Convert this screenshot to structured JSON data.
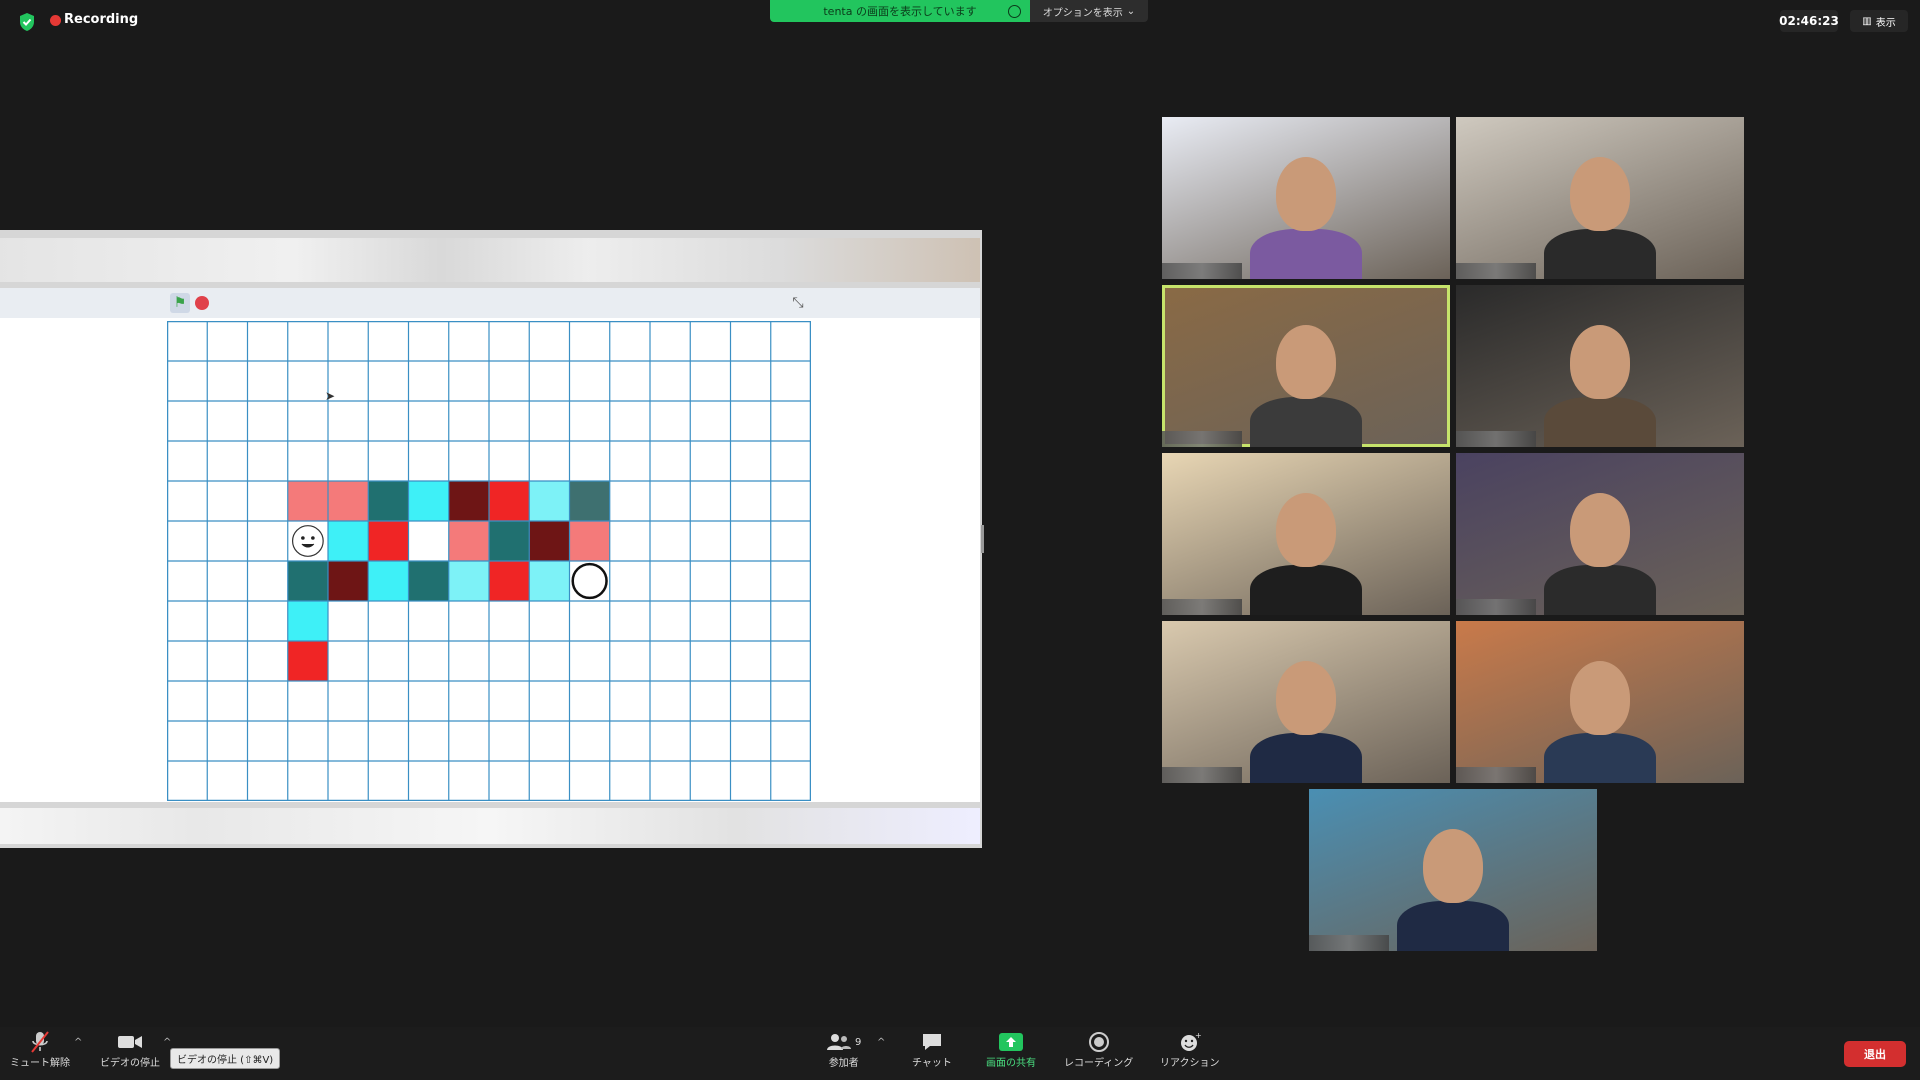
{
  "top_bar": {
    "recording_label": "Recording",
    "share_banner": "tenta の画面を表示しています",
    "options_label": "オプションを表示",
    "clock": "02:46:23",
    "view_label": "表示"
  },
  "stage": {
    "grid_cols": 16,
    "grid_rows": 12,
    "colored_cells": [
      {
        "row": 4,
        "col": 3,
        "color": "#f47a7a"
      },
      {
        "row": 4,
        "col": 4,
        "color": "#f47a7a"
      },
      {
        "row": 4,
        "col": 5,
        "color": "#207070"
      },
      {
        "row": 4,
        "col": 6,
        "color": "#3ef0f7"
      },
      {
        "row": 4,
        "col": 7,
        "color": "#6e1515"
      },
      {
        "row": 4,
        "col": 8,
        "color": "#f02525"
      },
      {
        "row": 4,
        "col": 9,
        "color": "#7df2f7"
      },
      {
        "row": 4,
        "col": 10,
        "color": "#3e7070"
      },
      {
        "row": 5,
        "col": 4,
        "color": "#3ef0f7"
      },
      {
        "row": 5,
        "col": 5,
        "color": "#f02525"
      },
      {
        "row": 5,
        "col": 6,
        "color": "#ffffff"
      },
      {
        "row": 5,
        "col": 7,
        "color": "#f47a7a"
      },
      {
        "row": 5,
        "col": 8,
        "color": "#207070"
      },
      {
        "row": 5,
        "col": 9,
        "color": "#6e1515"
      },
      {
        "row": 5,
        "col": 10,
        "color": "#f47a7a"
      },
      {
        "row": 6,
        "col": 3,
        "color": "#207070"
      },
      {
        "row": 6,
        "col": 4,
        "color": "#6e1515"
      },
      {
        "row": 6,
        "col": 5,
        "color": "#3ef0f7"
      },
      {
        "row": 6,
        "col": 6,
        "color": "#207070"
      },
      {
        "row": 6,
        "col": 7,
        "color": "#7df2f7"
      },
      {
        "row": 6,
        "col": 8,
        "color": "#f02525"
      },
      {
        "row": 6,
        "col": 9,
        "color": "#7df2f7"
      },
      {
        "row": 7,
        "col": 3,
        "color": "#3ef0f7"
      },
      {
        "row": 8,
        "col": 3,
        "color": "#f02525"
      }
    ],
    "smiley_cell": {
      "row": 5,
      "col": 3
    },
    "circle_cell": {
      "row": 6,
      "col": 10
    }
  },
  "participants_tiles": [
    {
      "bg": "#e9ecf4",
      "accent": "#7b5aa0"
    },
    {
      "bg": "#cfc9bf",
      "accent": "#2a2a2a"
    },
    {
      "bg": "#8a6a45",
      "accent": "#3b3b3b"
    },
    {
      "bg": "#2a2a2a",
      "accent": "#5a4a3a"
    },
    {
      "bg": "#e8d6b4",
      "accent": "#1e1e1e"
    },
    {
      "bg": "#4a4260",
      "accent": "#2b2b2b"
    },
    {
      "bg": "#d9c9ae",
      "accent": "#1f2a44"
    },
    {
      "bg": "#c97a4a",
      "accent": "#2a3a55"
    },
    {
      "bg": "#4a8fb3",
      "accent": "#1f2a44"
    }
  ],
  "toolbar": {
    "mute_label": "ミュート解除",
    "video_label": "ビデオの停止",
    "video_tooltip": "ビデオの停止 (⇧⌘V)",
    "participants_label": "参加者",
    "participants_count": "9",
    "chat_label": "チャット",
    "share_label": "画面の共有",
    "record_label": "レコーディング",
    "reaction_label": "リアクション",
    "leave_label": "退出"
  }
}
